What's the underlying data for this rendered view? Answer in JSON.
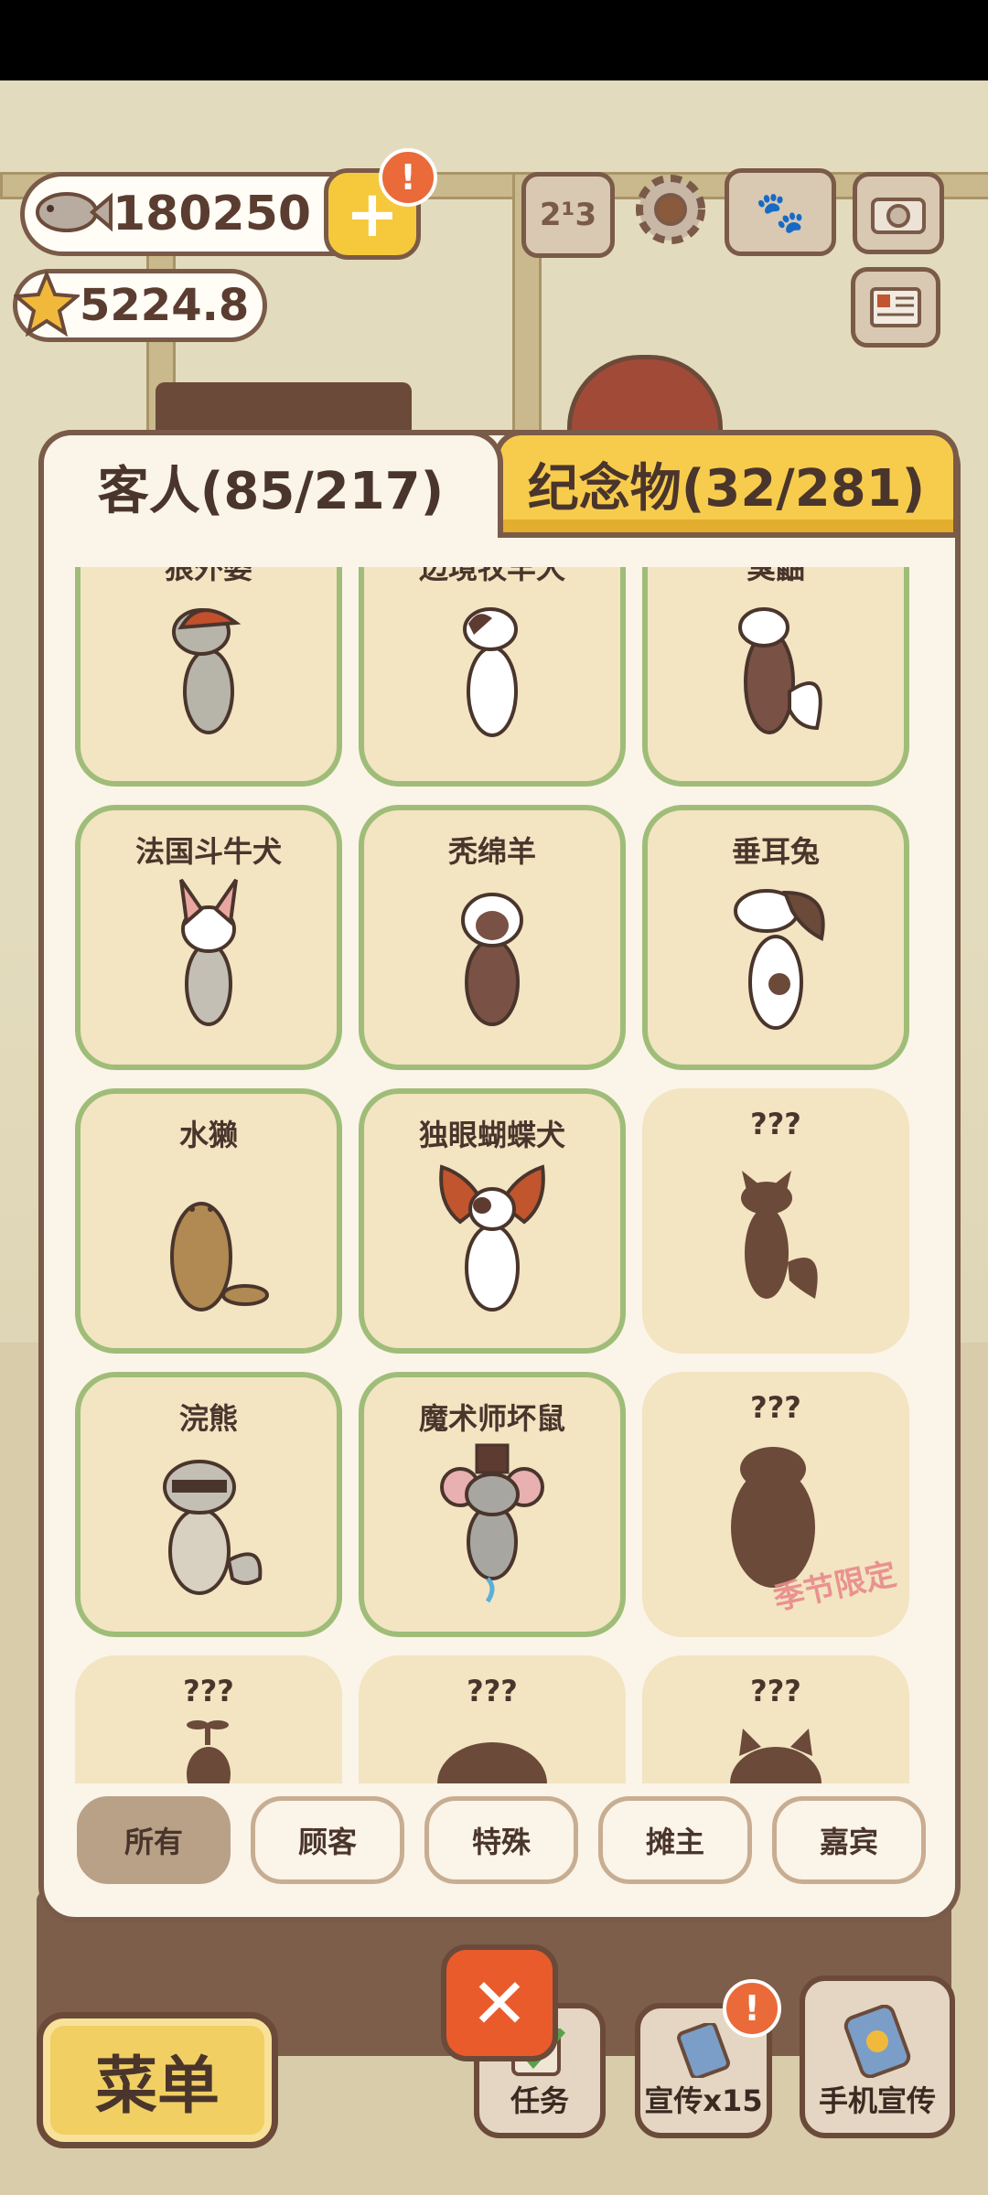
{
  "currency": {
    "fish": "180250",
    "stars": "5224.8"
  },
  "tabs": {
    "guests": "客人(85/217)",
    "souvenirs": "纪念物(32/281)"
  },
  "grid": {
    "row0": [
      "狼外婆",
      "边境牧羊犬",
      "臭鼬"
    ],
    "row1": [
      "法国斗牛犬",
      "秃绵羊",
      "垂耳兔"
    ],
    "row2": [
      "水獭",
      "独眼蝴蝶犬",
      "???"
    ],
    "row3": [
      "浣熊",
      "魔术师坏鼠",
      "???"
    ],
    "row4": [
      "???",
      "???",
      "???"
    ],
    "season_label": "季节限定"
  },
  "filters": [
    "所有",
    "顾客",
    "特殊",
    "摊主",
    "嘉宾"
  ],
  "bottom": {
    "menu": "菜单",
    "tasks": "任务",
    "promo": "宣传x15",
    "phone_promo": "手机宣传"
  },
  "icons": [
    "fish-icon",
    "plus-icon",
    "star-icon",
    "ranking-icon",
    "gear-icon",
    "book-icon",
    "camera-icon",
    "newspaper-icon",
    "close-icon"
  ],
  "colors": {
    "panel_border": "#7a5a48",
    "card_unlocked_border": "#9fbd78",
    "tab_inactive": "#f7cc4d",
    "close_button": "#ea5b2b"
  }
}
